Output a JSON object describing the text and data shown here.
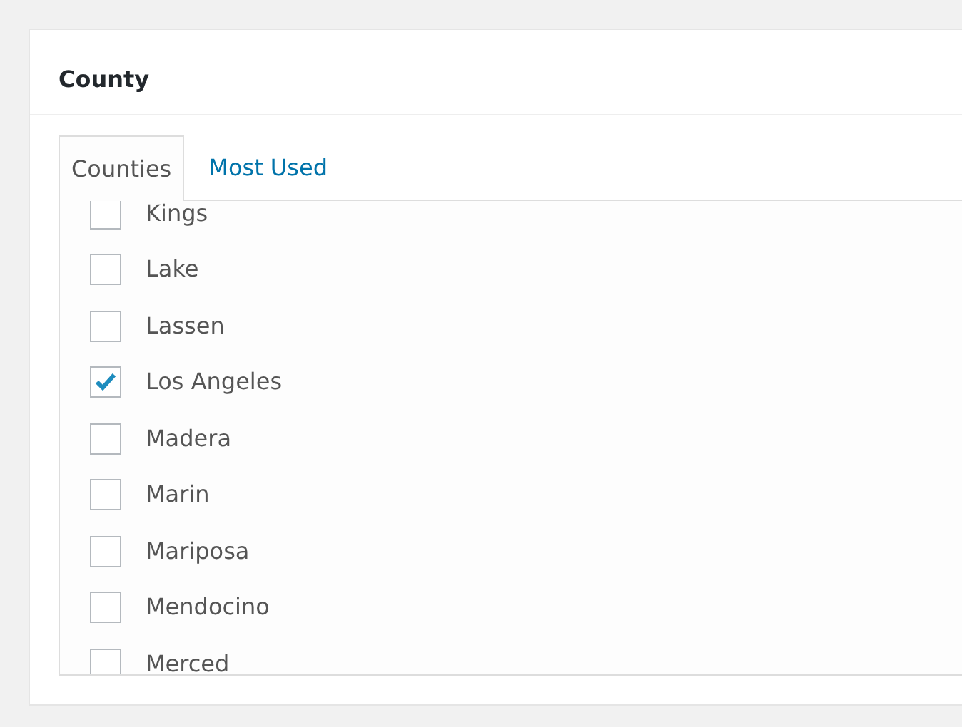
{
  "panel": {
    "title": "County"
  },
  "tabs": [
    {
      "label": "Counties",
      "selected": true
    },
    {
      "label": "Most Used",
      "selected": false
    }
  ],
  "items": [
    {
      "label": "Kings",
      "checked": false
    },
    {
      "label": "Lake",
      "checked": false
    },
    {
      "label": "Lassen",
      "checked": false
    },
    {
      "label": "Los Angeles",
      "checked": true
    },
    {
      "label": "Madera",
      "checked": false
    },
    {
      "label": "Marin",
      "checked": false
    },
    {
      "label": "Mariposa",
      "checked": false
    },
    {
      "label": "Mendocino",
      "checked": false
    },
    {
      "label": "Merced",
      "checked": false
    }
  ]
}
